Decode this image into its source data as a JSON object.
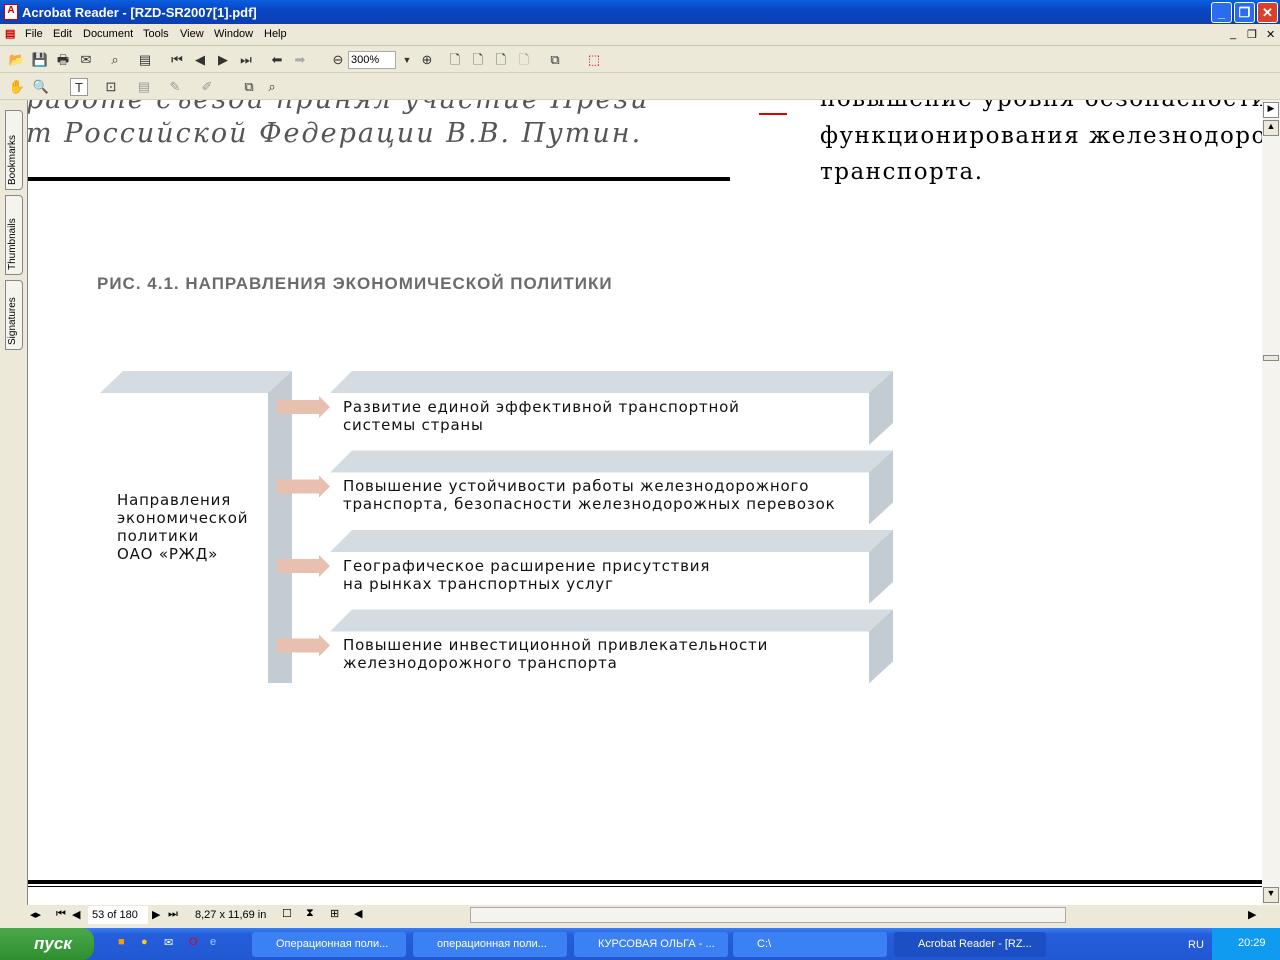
{
  "window": {
    "title": "Acrobat Reader - [RZD-SR2007[1].pdf]",
    "minimize": "_",
    "restore": "❐",
    "close": "✕"
  },
  "menu": [
    "File",
    "Edit",
    "Document",
    "Tools",
    "View",
    "Window",
    "Help"
  ],
  "toolbar": {
    "zoom": "300%"
  },
  "side_tabs": [
    "Bookmarks",
    "Thumbnails",
    "Signatures"
  ],
  "page": {
    "top_left_line1": "работе съезда принял участие Прези",
    "top_left_line2": "т Российской Федерации В.В. Путин.",
    "top_right_line1": "повышение уровня безопасности",
    "top_right_line2": "функционирования железнодорожного",
    "top_right_line3": "транспорта.",
    "figure_title": "РИС. 4.1. НАПРАВЛЕНИЯ ЭКОНОМИЧЕСКОЙ ПОЛИТИКИ",
    "root_label": [
      "Направления",
      "экономической",
      "политики",
      "ОАО «РЖД»"
    ],
    "directions": [
      [
        "Развитие единой эффективной транспортной",
        "системы страны"
      ],
      [
        "Повышение устойчивости работы железнодорожного",
        "транспорта, безопасности железнодорожных перевозок"
      ],
      [
        "Географическое расширение присутствия",
        "на рынках транспортных услуг"
      ],
      [
        "Повышение инвестиционной привлекательности",
        "железнодорожного транспорта"
      ]
    ]
  },
  "status": {
    "page": "53 of 180",
    "size": "8,27 x 11,69 in"
  },
  "taskbar": {
    "start": "пуск",
    "tasks": [
      "Операционная поли...",
      "операционная поли...",
      "КУРСОВАЯ ОЛЬГА - ...",
      "C:\\",
      "Acrobat Reader - [RZ..."
    ],
    "lang": "RU",
    "clock": "20:29"
  },
  "colors": {
    "arrow": "#e8c0b0",
    "band": "#d5dce1",
    "side": "#c3ccd3"
  }
}
